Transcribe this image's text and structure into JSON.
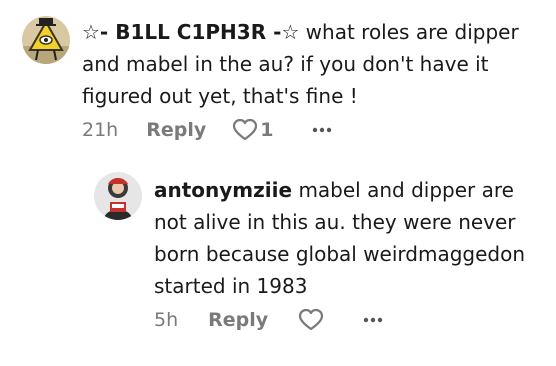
{
  "comments": [
    {
      "author": "☆- B1LL C1PH3R -☆",
      "text": "what roles are dipper and mabel in the au? if you don't have it figured out yet, that's fine !",
      "time": "21h",
      "reply_label": "Reply",
      "like_count": "1",
      "avatar_icon": "bill-cipher-avatar",
      "more_icon": "more-icon"
    },
    {
      "author": "antonymziie",
      "text": "mabel and dipper are not alive in this au. they were never born because global weirdmaggedon started in 1983",
      "time": "5h",
      "reply_label": "Reply",
      "avatar_icon": "user-avatar",
      "more_icon": "more-icon"
    }
  ],
  "colors": {
    "text": "#1a1a1a",
    "muted": "#7a7a7a",
    "background": "#ffffff"
  }
}
